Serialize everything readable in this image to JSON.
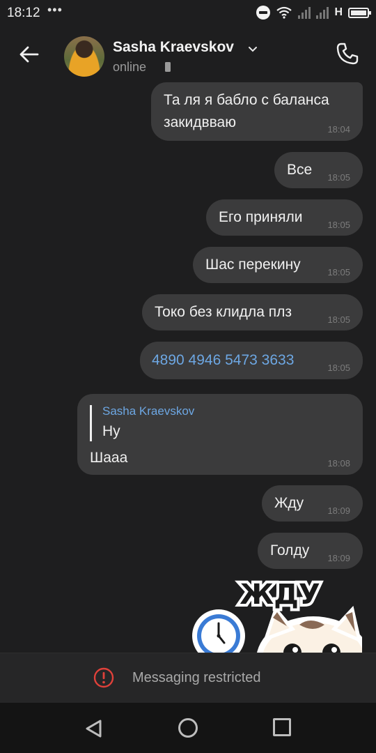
{
  "status_bar": {
    "time": "18:12",
    "dots": "•••",
    "network": "H"
  },
  "header": {
    "contact_name": "Sasha Kraevskov",
    "status": "online"
  },
  "messages": [
    {
      "line1": "Та ля я бабло с баланса",
      "line2": "закидвваю",
      "time": "18:04"
    },
    {
      "text": "Все",
      "time": "18:05"
    },
    {
      "text": "Его приняли",
      "time": "18:05"
    },
    {
      "text": "Шас перекину",
      "time": "18:05"
    },
    {
      "text": "Токо без клидла плз",
      "time": "18:05"
    },
    {
      "text": "4890 4946 5473 3633",
      "time": "18:05",
      "is_link": true
    },
    {
      "reply_author": "Sasha Kraevskov",
      "reply_text": "Ну",
      "text": "Шааа",
      "time": "18:08"
    },
    {
      "text": "Жду",
      "time": "18:09"
    },
    {
      "text": "Голду",
      "time": "18:09"
    }
  ],
  "sticker": {
    "caption": "ЖДУ"
  },
  "footer": {
    "restricted_label": "Messaging restricted"
  },
  "colors": {
    "background": "#1e1e1f",
    "bubble": "#3b3b3c",
    "link": "#6da7e3",
    "warning": "#e0413a"
  }
}
